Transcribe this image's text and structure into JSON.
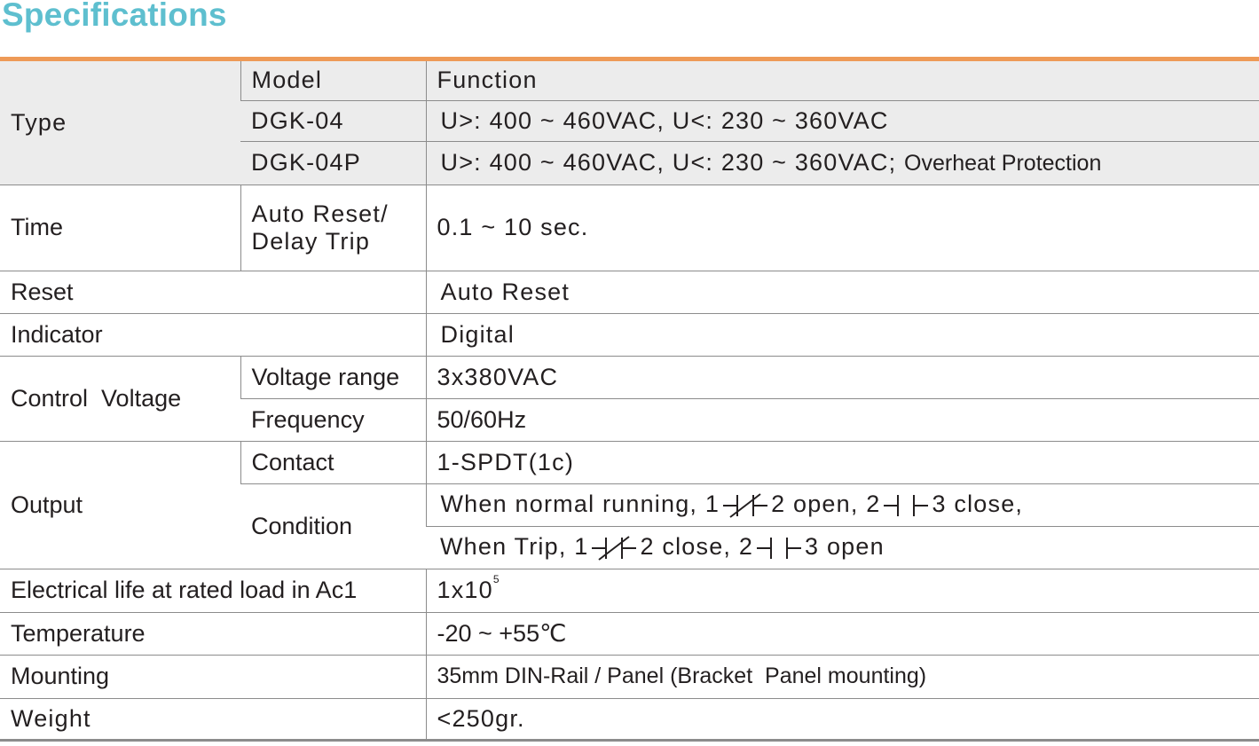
{
  "title": "Specifications",
  "rows": {
    "type": {
      "label": "Type",
      "model_header": "Model",
      "function_header": "Function",
      "models": [
        {
          "model": "DGK-04",
          "function": "U>: 400 ~ 460VAC, U<: 230 ~ 360VAC"
        },
        {
          "model": "DGK-04P",
          "function": "U>: 400 ~ 460VAC, U<: 230 ~ 360VAC;",
          "extra": "Overheat Protection"
        }
      ]
    },
    "time": {
      "label": "Time",
      "sub_line1": "Auto Reset/",
      "sub_line2": "Delay Trip",
      "value": "0.1 ~ 10 sec."
    },
    "reset": {
      "label": "Reset",
      "value": "Auto Reset"
    },
    "indicator": {
      "label": "Indicator",
      "value": "Digital"
    },
    "control_voltage": {
      "label": "Control  Voltage",
      "voltage_range_label": "Voltage range",
      "voltage_range_value": "3x380VAC",
      "frequency_label": "Frequency",
      "frequency_value": "50/60Hz"
    },
    "output": {
      "label": "Output",
      "contact_label": "Contact",
      "contact_value": "1-SPDT(1c)",
      "condition_label": "Condition",
      "cond1": {
        "a": "When normal running,  1",
        "b": "2 open, 2",
        "c": "3 close,"
      },
      "cond2": {
        "a": "When Trip, 1",
        "b": "2 close, 2",
        "c": "3 open"
      }
    },
    "electrical_life": {
      "label": "Electrical life at rated load in Ac1",
      "base": "1x10",
      "exponent": "5"
    },
    "temperature": {
      "label": "Temperature",
      "value": "-20 ~ +55℃"
    },
    "mounting": {
      "label": "Mounting",
      "value": "35mm DIN-Rail / Panel (Bracket  Panel mounting)"
    },
    "weight": {
      "label": "Weight",
      "value": "<250gr."
    }
  }
}
